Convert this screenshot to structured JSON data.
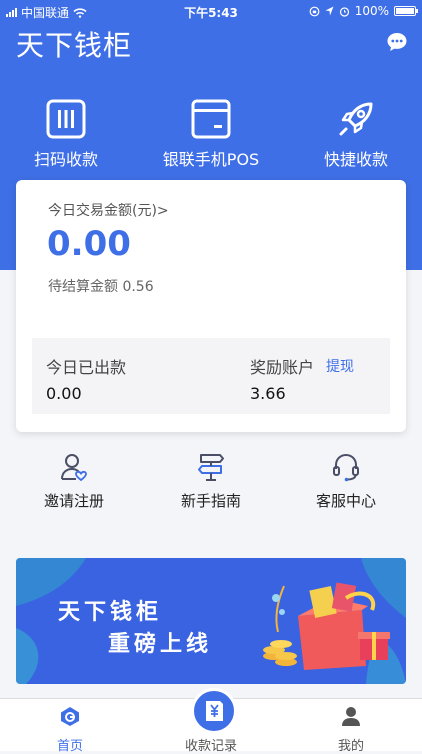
{
  "status_bar": {
    "carrier": "中国联通",
    "time": "下午5:43",
    "battery": "100%"
  },
  "header": {
    "title": "天下钱柜"
  },
  "quick_actions": [
    {
      "label": "扫码收款",
      "icon": "scan-icon"
    },
    {
      "label": "银联手机POS",
      "icon": "card-reader-icon"
    },
    {
      "label": "快捷收款",
      "icon": "rocket-icon"
    }
  ],
  "summary": {
    "today_label": "今日交易金额(元)>",
    "today_amount": "0.00",
    "pending_label": "待结算金额",
    "pending_amount": "0.56",
    "paid_label": "今日已出款",
    "paid_amount": "0.00",
    "reward_label": "奖励账户",
    "withdraw_label": "提现",
    "reward_amount": "3.66"
  },
  "services": [
    {
      "label": "邀请注册",
      "icon": "invite-user-icon"
    },
    {
      "label": "新手指南",
      "icon": "signpost-icon"
    },
    {
      "label": "客服中心",
      "icon": "headset-icon"
    }
  ],
  "banner": {
    "line1": "天下钱柜",
    "line2": "重磅上线"
  },
  "tabs": [
    {
      "label": "首页",
      "icon": "home-icon",
      "active": true
    },
    {
      "label": "收款记录",
      "icon": "yuan-receipt-icon",
      "active": false
    },
    {
      "label": "我的",
      "icon": "profile-icon",
      "active": false
    }
  ],
  "colors": {
    "brand": "#3f6fe6",
    "banner_bg": "#3a63e2"
  }
}
